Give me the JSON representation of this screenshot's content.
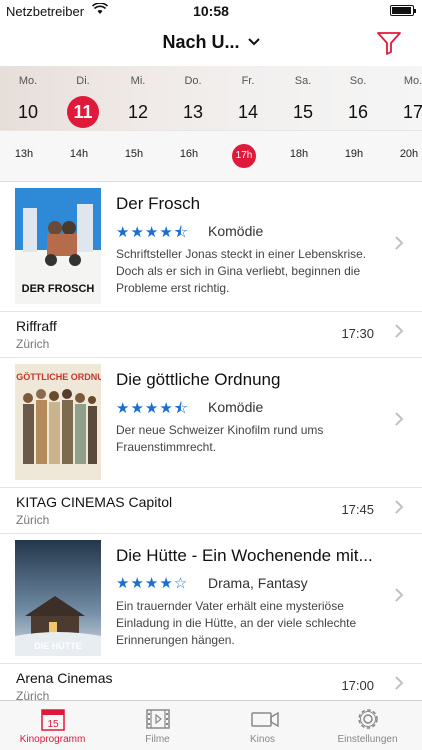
{
  "status_bar": {
    "carrier": "Netzbetreiber",
    "time": "10:58"
  },
  "nav": {
    "title": "Nach U...",
    "icons": [
      "chevron-down-icon",
      "filter-icon"
    ]
  },
  "days": [
    {
      "dow": "Mo.",
      "num": "10"
    },
    {
      "dow": "Di.",
      "num": "11",
      "selected": true
    },
    {
      "dow": "Mi.",
      "num": "12"
    },
    {
      "dow": "Do.",
      "num": "13"
    },
    {
      "dow": "Fr.",
      "num": "14"
    },
    {
      "dow": "Sa.",
      "num": "15"
    },
    {
      "dow": "So.",
      "num": "16"
    },
    {
      "dow": "Mo.",
      "num": "17"
    }
  ],
  "hours": [
    "13h",
    "14h",
    "15h",
    "16h",
    "17h",
    "18h",
    "19h",
    "20h"
  ],
  "selected_hour": "17h",
  "movies": [
    {
      "title": "Der Frosch",
      "rating": 4.5,
      "stars_display": "★★★★⯪",
      "genre": "Komödie",
      "description": "Schriftsteller Jonas steckt in einer Lebenskrise. Doch als er sich in Gina verliebt, beginnen die Probleme erst richtig.",
      "poster_text": "DER FROSCH",
      "cinema": {
        "name": "Riffraff",
        "city": "Zürich",
        "time": "17:30"
      }
    },
    {
      "title": "Die göttliche Ordnung",
      "rating": 4.5,
      "stars_display": "★★★★⯪",
      "genre": "Komödie",
      "description": "Der neue Schweizer Kinofilm rund ums Frauenstimmrecht.",
      "poster_text": "DIE GÖTTLICHE ORDNUNG",
      "cinema": {
        "name": "KITAG CINEMAS Capitol",
        "city": "Zürich",
        "time": "17:45"
      }
    },
    {
      "title": "Die Hütte - Ein Wochenende mit...",
      "rating": 4,
      "stars_display": "★★★★☆",
      "genre": "Drama, Fantasy",
      "description": "Ein trauernder Vater erhält eine mysteriöse Einladung in die Hütte, an der viele schlechte Erinnerungen hängen.",
      "poster_text": "DIE HÜTTE",
      "cinema": {
        "name": "Arena Cinemas",
        "city": "Zürich",
        "time": "17:00"
      }
    }
  ],
  "tabs": [
    {
      "label": "Kinoprogramm",
      "icon": "calendar-icon",
      "badge": "15",
      "active": true
    },
    {
      "label": "Filme",
      "icon": "film-icon"
    },
    {
      "label": "Kinos",
      "icon": "camera-icon"
    },
    {
      "label": "Einstellungen",
      "icon": "gear-icon"
    }
  ],
  "colors": {
    "accent": "#e0193a",
    "stars": "#1b6fd1"
  }
}
